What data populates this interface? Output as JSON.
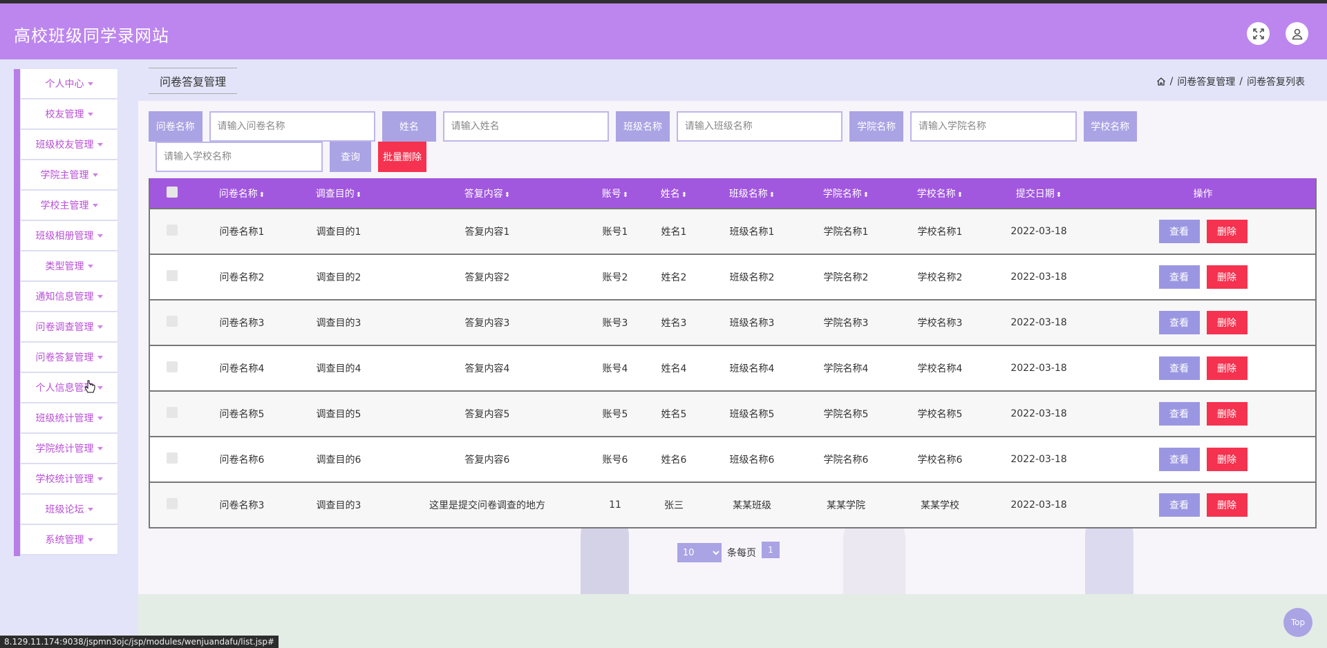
{
  "app": {
    "title": "高校班级同学录网站"
  },
  "header": {
    "fullscreen_icon": "expand-icon",
    "user_icon": "user-icon"
  },
  "sidebar": {
    "items": [
      {
        "label": "个人中心"
      },
      {
        "label": "校友管理"
      },
      {
        "label": "班级校友管理"
      },
      {
        "label": "学院主管理"
      },
      {
        "label": "学校主管理"
      },
      {
        "label": "班级相册管理"
      },
      {
        "label": "类型管理"
      },
      {
        "label": "通知信息管理"
      },
      {
        "label": "问卷调查管理"
      },
      {
        "label": "问卷答复管理"
      },
      {
        "label": "个人信息管理"
      },
      {
        "label": "班级统计管理"
      },
      {
        "label": "学院统计管理"
      },
      {
        "label": "学校统计管理"
      },
      {
        "label": "班级论坛"
      },
      {
        "label": "系统管理"
      }
    ]
  },
  "page": {
    "tab": "问卷答复管理",
    "breadcrumb": [
      "问卷答复管理",
      "问卷答复列表"
    ]
  },
  "search": {
    "fields": [
      {
        "label": "问卷名称",
        "placeholder": "请输入问卷名称"
      },
      {
        "label": "姓名",
        "placeholder": "请输入姓名"
      },
      {
        "label": "班级名称",
        "placeholder": "请输入班级名称"
      },
      {
        "label": "学院名称",
        "placeholder": "请输入学院名称"
      },
      {
        "label": "学校名称",
        "placeholder": "请输入学校名称"
      }
    ],
    "query_label": "查询",
    "bulk_delete_label": "批量删除"
  },
  "table": {
    "columns": [
      "问卷名称",
      "调查目的",
      "答复内容",
      "账号",
      "姓名",
      "班级名称",
      "学院名称",
      "学校名称",
      "提交日期",
      "操作"
    ],
    "view_label": "查看",
    "delete_label": "删除",
    "rows": [
      [
        "问卷名称1",
        "调查目的1",
        "答复内容1",
        "账号1",
        "姓名1",
        "班级名称1",
        "学院名称1",
        "学校名称1",
        "2022-03-18"
      ],
      [
        "问卷名称2",
        "调查目的2",
        "答复内容2",
        "账号2",
        "姓名2",
        "班级名称2",
        "学院名称2",
        "学校名称2",
        "2022-03-18"
      ],
      [
        "问卷名称3",
        "调查目的3",
        "答复内容3",
        "账号3",
        "姓名3",
        "班级名称3",
        "学院名称3",
        "学校名称3",
        "2022-03-18"
      ],
      [
        "问卷名称4",
        "调查目的4",
        "答复内容4",
        "账号4",
        "姓名4",
        "班级名称4",
        "学院名称4",
        "学校名称4",
        "2022-03-18"
      ],
      [
        "问卷名称5",
        "调查目的5",
        "答复内容5",
        "账号5",
        "姓名5",
        "班级名称5",
        "学院名称5",
        "学校名称5",
        "2022-03-18"
      ],
      [
        "问卷名称6",
        "调查目的6",
        "答复内容6",
        "账号6",
        "姓名6",
        "班级名称6",
        "学院名称6",
        "学校名称6",
        "2022-03-18"
      ],
      [
        "问卷名称3",
        "调查目的3",
        "这里是提交问卷调查的地方",
        "11",
        "张三",
        "某某班级",
        "某某学院",
        "某某学校",
        "2022-03-18"
      ]
    ]
  },
  "pager": {
    "page_size": "10",
    "per_page_label": "条每页",
    "current_page": "1"
  },
  "status_bar": {
    "url": "8.129.11.174:9038/jspmn3ojc/jsp/modules/wenjuandafu/list.jsp#"
  },
  "top_button": {
    "label": "Top"
  },
  "colors": {
    "header": "#bd86ee",
    "accent": "#aaa3e4",
    "table_header": "#a157de",
    "danger": "#f5324f",
    "sidebar_text": "#b84fd6"
  }
}
